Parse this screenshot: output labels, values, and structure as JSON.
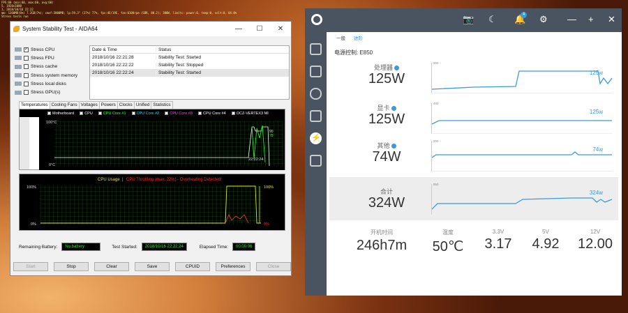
{
  "osd": {
    "lines": [
      "FPS:60 (min:60, max:60, avg:60)",
      "5, 1920x1080",
      "1, 2018/10/16 22:22",
      "mm: 1360MB(6%) 7.2GB(7%); cmaf:3000MB; lp:59,3° (27%) 77%, fps:4E/19E, fan:6100rpm (SBR, 80.2); 300W, limits: power:0, temp:0, volt:0, 84.0%",
      "Stress tests run"
    ]
  },
  "aida": {
    "title": "System Stability Test - AIDA64",
    "window_buttons": [
      "—",
      "☐",
      "✕"
    ],
    "stress_items": [
      {
        "label": "Stress CPU",
        "checked": true
      },
      {
        "label": "Stress FPU",
        "checked": false
      },
      {
        "label": "Stress cache",
        "checked": false
      },
      {
        "label": "Stress system memory",
        "checked": false
      },
      {
        "label": "Stress local disks",
        "checked": false
      },
      {
        "label": "Stress GPU(s)",
        "checked": false
      }
    ],
    "log_headers": [
      "Date & Time",
      "Status"
    ],
    "log_rows": [
      {
        "time": "2018/10/16 22:21:28",
        "status": "Stability Test: Started"
      },
      {
        "time": "2018/10/16 22:22:22",
        "status": "Stability Test: Stopped"
      },
      {
        "time": "2018/10/16 22:22:24",
        "status": "Stability Test: Started"
      }
    ],
    "tabs": [
      "Temperatures",
      "Cooling Fans",
      "Voltages",
      "Powers",
      "Clocks",
      "Unified",
      "Statistics"
    ],
    "temp_legend": [
      "Motherboard",
      "CPU",
      "CPU Core #1",
      "CPU Core #2",
      "CPU Core #3",
      "CPU Core #4",
      "OCZ-VERTEX3 MI"
    ],
    "temp_legend_colors": [
      "#ffffff",
      "#ffffff",
      "#33ff33",
      "#22ddff",
      "#ff44ff",
      "#ffffff",
      "#ffffff"
    ],
    "temp_axis_top": "100°C",
    "temp_axis_bottom": "0°C",
    "temp_time": "22:22:24",
    "temp_values": [
      "90",
      "78"
    ],
    "usage_title_a": "CPU Usage",
    "usage_sep": "|",
    "usage_title_b": "CPU Throttling (max: 22%) - Overheating Detected!",
    "usage_top": "100%",
    "usage_bottom": "0%",
    "usage_right_top": "100%",
    "usage_right_bottom": "0%",
    "remaining_battery_label": "Remaining Battery:",
    "remaining_battery": "No battery",
    "test_started_label": "Test Started:",
    "test_started": "2018/10/16 22:22:24",
    "elapsed_label": "Elapsed Time:",
    "elapsed": "00:00:06",
    "buttons": [
      "Start",
      "Stop",
      "Clear",
      "Save",
      "CPUID",
      "Preferences",
      "Close"
    ]
  },
  "power": {
    "subtabs": [
      "一般",
      "进阶"
    ],
    "model": "电源控制: E850",
    "rows": [
      {
        "label": "处理器",
        "value": "125W",
        "gtop": "350",
        "gval": "125w"
      },
      {
        "label": "显卡",
        "value": "125W",
        "gtop": "400",
        "gval": "125w"
      },
      {
        "label": "其他",
        "value": "74W",
        "gtop": "250",
        "gval": "74w"
      },
      {
        "label": "合计",
        "value": "324W",
        "gtop": "850",
        "gval": "324w"
      }
    ],
    "stats": [
      {
        "label": "开机时间",
        "value": "246h7m"
      },
      {
        "label": "温度",
        "value": "50℃"
      },
      {
        "label": "3.3V",
        "value": "3.17"
      },
      {
        "label": "5V",
        "value": "4.92"
      },
      {
        "label": "12V",
        "value": "12.00"
      }
    ],
    "notify_count": "4",
    "accent": "#3a9ad9",
    "titlebar_color": "#4a5460"
  }
}
